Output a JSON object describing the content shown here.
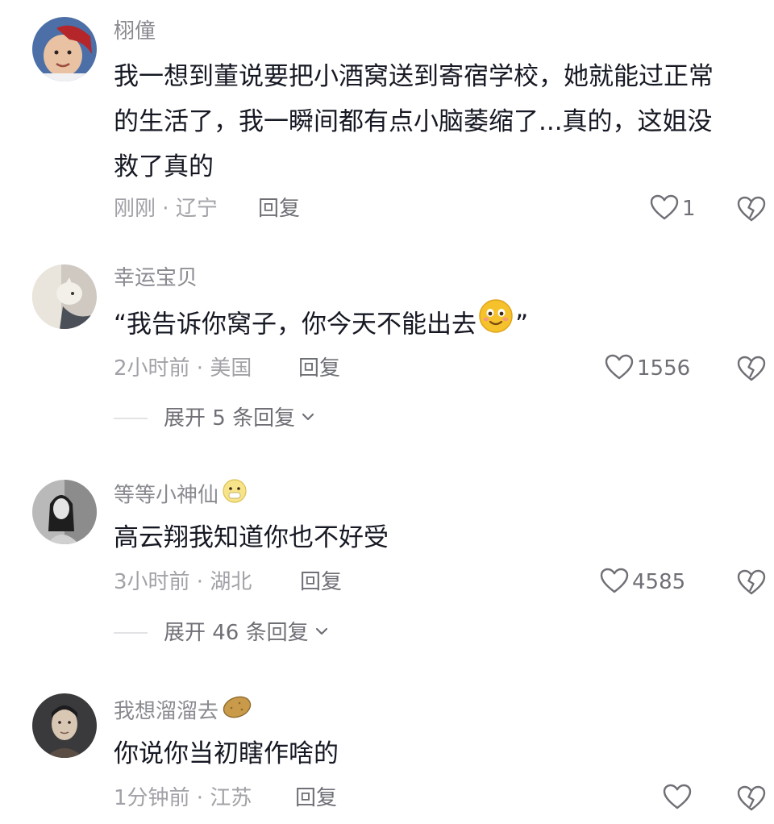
{
  "comments": [
    {
      "username": "栩僮",
      "lines": [
        "我一想到董说要把小酒窝送到寄宿学校，她就能过正常",
        "的生活了，我一瞬间都有点小脑萎缩了...真的，这姐没",
        "救了真的"
      ],
      "time": "刚刚",
      "location": "辽宁",
      "reply_label": "回复",
      "likes": "1"
    },
    {
      "username": "幸运宝贝",
      "text_before": "“我告诉你窝子，你今天不能出去",
      "text_emoji": "smiling-face-emoji",
      "text_after": "”",
      "time": "2小时前",
      "location": "美国",
      "reply_label": "回复",
      "likes": "1556",
      "expand_label": "展开 5 条回复"
    },
    {
      "username": "等等小神仙",
      "name_emoji": "speechless-face-emoji",
      "text": "高云翔我知道你也不好受",
      "time": "3小时前",
      "location": "湖北",
      "reply_label": "回复",
      "likes": "4585",
      "expand_label": "展开 46 条回复"
    },
    {
      "username": "我想溜溜去",
      "name_emoji": "potato-emoji",
      "text": "你说你当初瞎作啥的",
      "time": "1分钟前",
      "location": "江苏",
      "reply_label": "回复",
      "likes": ""
    }
  ],
  "meta_separator": " · ",
  "icons": {
    "like": "heart-outline-icon",
    "dislike": "broken-heart-icon",
    "expand": "chevron-down-icon"
  },
  "colors": {
    "text_primary": "#161823",
    "text_secondary": "#8a8b91",
    "meta": "#a1a2a7"
  }
}
